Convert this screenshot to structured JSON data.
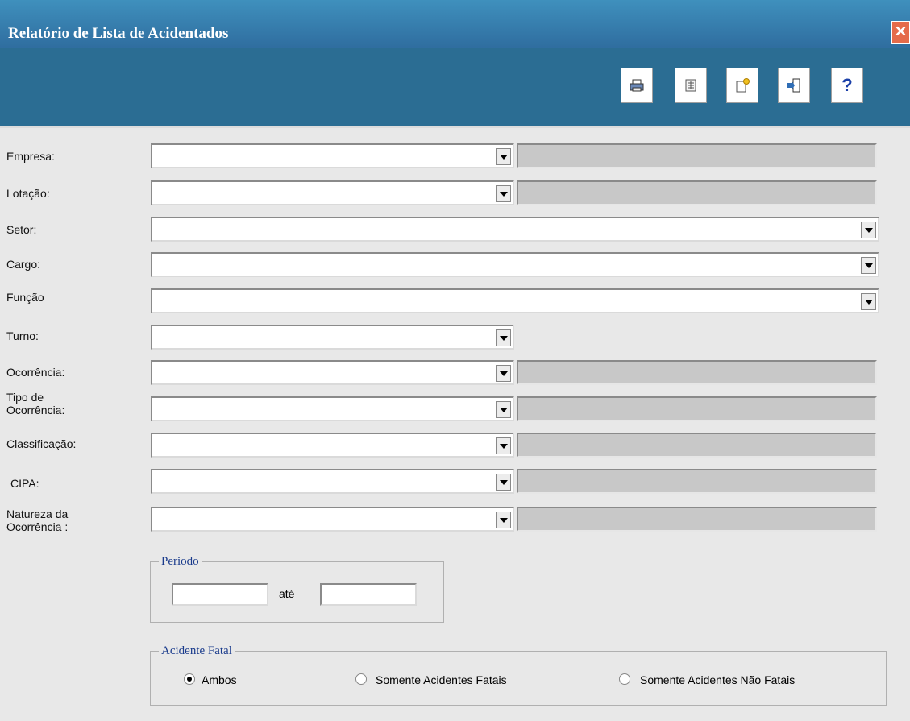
{
  "window": {
    "title": "Relatório de Lista de Acidentados",
    "close_label": "✕"
  },
  "toolbar": {
    "buttons": [
      {
        "icon": "print-icon"
      },
      {
        "icon": "report-icon"
      },
      {
        "icon": "new-document-icon"
      },
      {
        "icon": "exit-icon"
      },
      {
        "icon": "help-icon",
        "label": "?"
      }
    ]
  },
  "form": {
    "empresa_label": "Empresa:",
    "lotacao_label": "Lotação:",
    "setor_label": "Setor:",
    "cargo_label": "Cargo:",
    "funcao_label": "Função",
    "turno_label": "Turno:",
    "ocorrencia_label": "Ocorrência:",
    "tipo_ocorrencia_label_1": "Tipo de",
    "tipo_ocorrencia_label_2": "Ocorrência:",
    "classificacao_label": "Classificação:",
    "cipa_label": "CIPA:",
    "natureza_label_1": "Natureza da",
    "natureza_label_2": "Ocorrência :"
  },
  "periodo": {
    "legend": "Periodo",
    "separator": "até"
  },
  "acidente_fatal": {
    "legend": "Acidente Fatal",
    "options": [
      "Ambos",
      "Somente Acidentes Fatais",
      "Somente Acidentes Não Fatais"
    ],
    "selected": "Ambos"
  },
  "colors": {
    "titlebar": "#3378a8",
    "toolbar": "#2b6d93",
    "legend_text": "#1a3b8c"
  }
}
